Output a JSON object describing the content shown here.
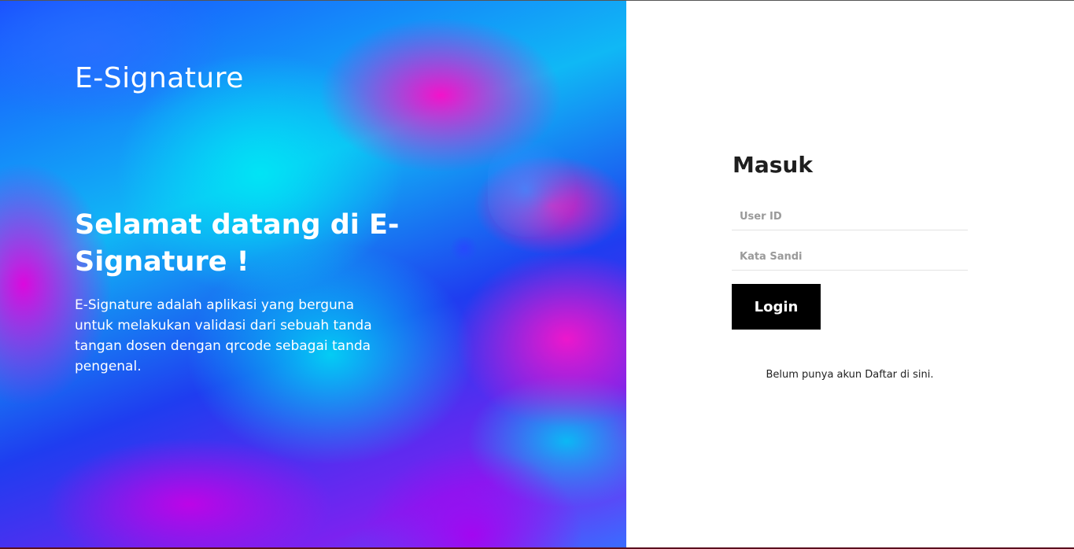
{
  "hero": {
    "brand": "E-Signature",
    "heading": "Selamat datang di E-Signature !",
    "description": "E-Signature adalah aplikasi yang berguna untuk melakukan validasi dari sebuah tanda tangan dosen dengan qrcode sebagai tanda pengenal."
  },
  "login": {
    "title": "Masuk",
    "userid_placeholder": "User ID",
    "password_placeholder": "Kata Sandi",
    "button_label": "Login",
    "signup_prefix": "Belum punya akun",
    "signup_link": "Daftar di sini."
  },
  "colors": {
    "button_bg": "#000000",
    "button_text": "#ffffff",
    "hero_gradient_primary": "#1a50ff",
    "hero_gradient_cyan": "#00e6f5",
    "hero_gradient_magenta": "#ff14b4"
  }
}
